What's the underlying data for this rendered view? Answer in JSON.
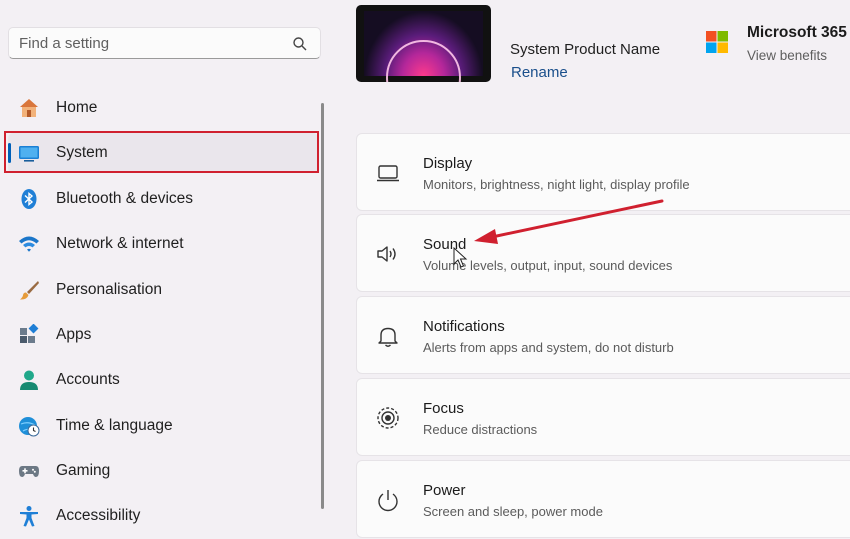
{
  "search": {
    "placeholder": "Find a setting",
    "icon": "search-icon"
  },
  "sidebar": {
    "items": [
      {
        "label": "Home",
        "icon": "home-icon"
      },
      {
        "label": "System",
        "icon": "system-icon",
        "active": true
      },
      {
        "label": "Bluetooth & devices",
        "icon": "bluetooth-icon"
      },
      {
        "label": "Network & internet",
        "icon": "wifi-icon"
      },
      {
        "label": "Personalisation",
        "icon": "brush-icon"
      },
      {
        "label": "Apps",
        "icon": "apps-icon"
      },
      {
        "label": "Accounts",
        "icon": "accounts-icon"
      },
      {
        "label": "Time & language",
        "icon": "globe-clock-icon"
      },
      {
        "label": "Gaming",
        "icon": "gamepad-icon"
      },
      {
        "label": "Accessibility",
        "icon": "accessibility-icon"
      }
    ]
  },
  "header": {
    "product_name": "System Product Name",
    "rename": "Rename",
    "ms365_title": "Microsoft 365",
    "ms365_sub": "View benefits"
  },
  "cards": [
    {
      "title": "Display",
      "subtitle": "Monitors, brightness, night light, display profile",
      "icon": "monitor-icon"
    },
    {
      "title": "Sound",
      "subtitle": "Volume levels, output, input, sound devices",
      "icon": "speaker-icon"
    },
    {
      "title": "Notifications",
      "subtitle": "Alerts from apps and system, do not disturb",
      "icon": "bell-icon"
    },
    {
      "title": "Focus",
      "subtitle": "Reduce distractions",
      "icon": "focus-icon"
    },
    {
      "title": "Power",
      "subtitle": "Screen and sleep, power mode",
      "icon": "power-icon"
    }
  ],
  "colors": {
    "accent": "#005fb8",
    "highlight": "#d0202f"
  }
}
